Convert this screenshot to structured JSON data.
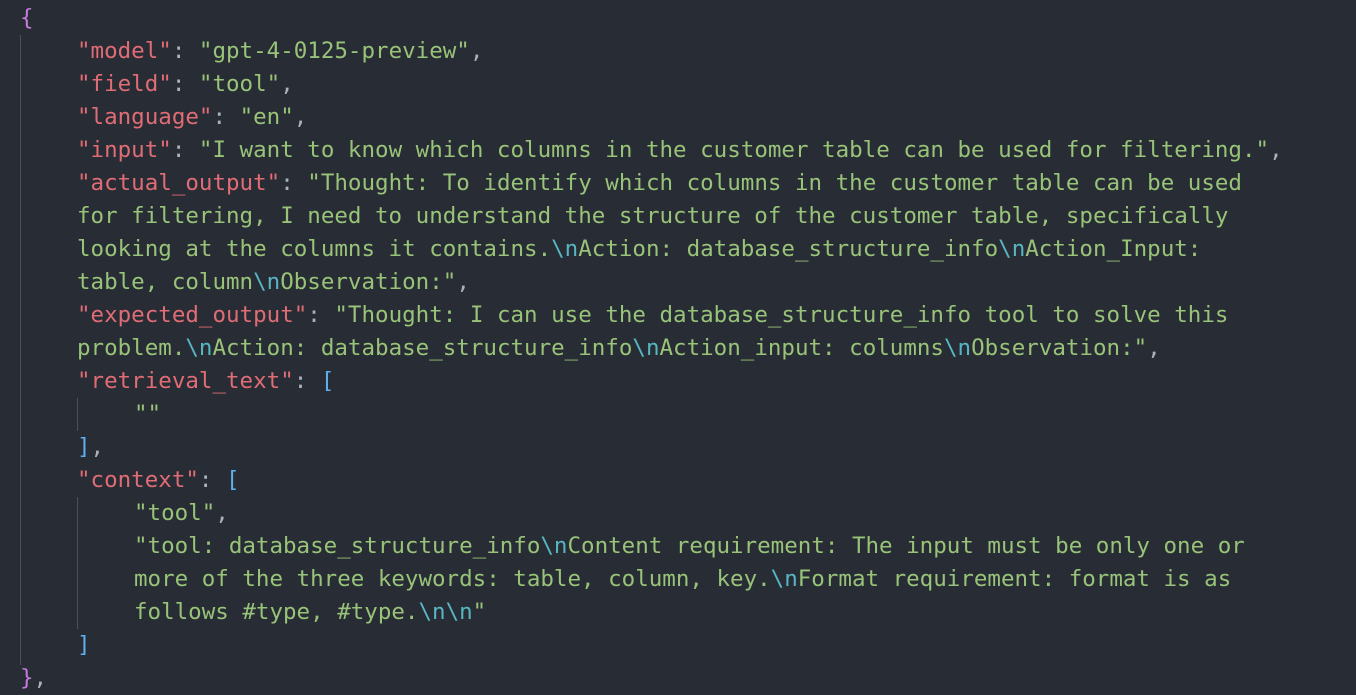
{
  "theme": {
    "background": "#282c34",
    "key_color": "#e06c75",
    "string_color": "#98c379",
    "escape_color": "#56b6c2",
    "brace_color": "#c678dd",
    "bracket_color": "#61afef",
    "punctuation_color": "#abb2bf",
    "guide_color": "#4b515c"
  },
  "lines": [
    {
      "indent": 0,
      "tokens": [
        {
          "t": "brace",
          "v": "{"
        }
      ]
    },
    {
      "indent": 1,
      "tokens": [
        {
          "t": "key",
          "v": "\"model\""
        },
        {
          "t": "punct",
          "v": ": "
        },
        {
          "t": "str",
          "v": "\"gpt-4-0125-preview\""
        },
        {
          "t": "punct",
          "v": ","
        }
      ]
    },
    {
      "indent": 1,
      "tokens": [
        {
          "t": "key",
          "v": "\"field\""
        },
        {
          "t": "punct",
          "v": ": "
        },
        {
          "t": "str",
          "v": "\"tool\""
        },
        {
          "t": "punct",
          "v": ","
        }
      ]
    },
    {
      "indent": 1,
      "tokens": [
        {
          "t": "key",
          "v": "\"language\""
        },
        {
          "t": "punct",
          "v": ": "
        },
        {
          "t": "str",
          "v": "\"en\""
        },
        {
          "t": "punct",
          "v": ","
        }
      ]
    },
    {
      "indent": 1,
      "tokens": [
        {
          "t": "key",
          "v": "\"input\""
        },
        {
          "t": "punct",
          "v": ": "
        },
        {
          "t": "str",
          "v": "\"I want to know which columns in the customer table can be used for filtering.\""
        },
        {
          "t": "punct",
          "v": ","
        }
      ]
    },
    {
      "indent": 1,
      "tokens": [
        {
          "t": "key",
          "v": "\"actual_output\""
        },
        {
          "t": "punct",
          "v": ": "
        },
        {
          "t": "str",
          "v": "\"Thought: To identify which columns in the customer table can be used"
        }
      ]
    },
    {
      "indent": 1,
      "tokens": [
        {
          "t": "str",
          "v": "for filtering, I need to understand the structure of the customer table, specifically"
        }
      ]
    },
    {
      "indent": 1,
      "tokens": [
        {
          "t": "str",
          "v": "looking at the columns it contains."
        },
        {
          "t": "esc",
          "v": "\\n"
        },
        {
          "t": "str",
          "v": "Action: database_structure_info"
        },
        {
          "t": "esc",
          "v": "\\n"
        },
        {
          "t": "str",
          "v": "Action_Input:"
        }
      ]
    },
    {
      "indent": 1,
      "tokens": [
        {
          "t": "str",
          "v": "table, column"
        },
        {
          "t": "esc",
          "v": "\\n"
        },
        {
          "t": "str",
          "v": "Observation:\""
        },
        {
          "t": "punct",
          "v": ","
        }
      ]
    },
    {
      "indent": 1,
      "tokens": [
        {
          "t": "key",
          "v": "\"expected_output\""
        },
        {
          "t": "punct",
          "v": ": "
        },
        {
          "t": "str",
          "v": "\"Thought: I can use the database_structure_info tool to solve this"
        }
      ]
    },
    {
      "indent": 1,
      "tokens": [
        {
          "t": "str",
          "v": "problem."
        },
        {
          "t": "esc",
          "v": "\\n"
        },
        {
          "t": "str",
          "v": "Action: database_structure_info"
        },
        {
          "t": "esc",
          "v": "\\n"
        },
        {
          "t": "str",
          "v": "Action_input: columns"
        },
        {
          "t": "esc",
          "v": "\\n"
        },
        {
          "t": "str",
          "v": "Observation:\""
        },
        {
          "t": "punct",
          "v": ","
        }
      ]
    },
    {
      "indent": 1,
      "tokens": [
        {
          "t": "key",
          "v": "\"retrieval_text\""
        },
        {
          "t": "punct",
          "v": ": "
        },
        {
          "t": "bracket",
          "v": "["
        }
      ]
    },
    {
      "indent": 2,
      "tokens": [
        {
          "t": "str",
          "v": "\"\""
        }
      ]
    },
    {
      "indent": 1,
      "tokens": [
        {
          "t": "bracket",
          "v": "]"
        },
        {
          "t": "punct",
          "v": ","
        }
      ]
    },
    {
      "indent": 1,
      "tokens": [
        {
          "t": "key",
          "v": "\"context\""
        },
        {
          "t": "punct",
          "v": ": "
        },
        {
          "t": "bracket",
          "v": "["
        }
      ]
    },
    {
      "indent": 2,
      "tokens": [
        {
          "t": "str",
          "v": "\"tool\""
        },
        {
          "t": "punct",
          "v": ","
        }
      ]
    },
    {
      "indent": 2,
      "tokens": [
        {
          "t": "str",
          "v": "\"tool: database_structure_info"
        },
        {
          "t": "esc",
          "v": "\\n"
        },
        {
          "t": "str",
          "v": "Content requirement: The input must be only one or"
        }
      ]
    },
    {
      "indent": 2,
      "tokens": [
        {
          "t": "str",
          "v": "more of the three keywords: table, column, key."
        },
        {
          "t": "esc",
          "v": "\\n"
        },
        {
          "t": "str",
          "v": "Format requirement: format is as"
        }
      ]
    },
    {
      "indent": 2,
      "tokens": [
        {
          "t": "str",
          "v": "follows #type, #type."
        },
        {
          "t": "esc",
          "v": "\\n\\n"
        },
        {
          "t": "str",
          "v": "\""
        }
      ]
    },
    {
      "indent": 1,
      "tokens": [
        {
          "t": "bracket",
          "v": "]"
        }
      ]
    },
    {
      "indent": 0,
      "tokens": [
        {
          "t": "brace",
          "v": "}"
        },
        {
          "t": "punct",
          "v": ","
        }
      ]
    }
  ]
}
